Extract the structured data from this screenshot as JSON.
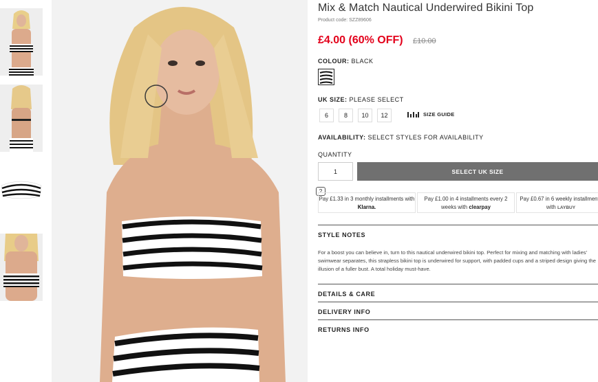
{
  "product": {
    "title": "Mix & Match Nautical Underwired Bikini Top",
    "product_code": "Product code: SZZ89606",
    "price_now": "£4.00 (60% OFF)",
    "price_was": "£10.00"
  },
  "colour": {
    "label": "COLOUR:",
    "value": "BLACK"
  },
  "size": {
    "label": "UK SIZE:",
    "value": "PLEASE SELECT",
    "options": [
      "6",
      "8",
      "10",
      "12"
    ],
    "guide_label": "SIZE GUIDE"
  },
  "availability": {
    "label": "AVAILABILITY:",
    "value": "SELECT STYLES FOR AVAILABILITY"
  },
  "quantity": {
    "label": "QUANTITY",
    "value": "1"
  },
  "select_button": "SELECT UK SIZE",
  "payment": {
    "help": "?",
    "klarna": {
      "text": "Pay £1.33 in 3 monthly installments with",
      "brand": "Klarna."
    },
    "clearpay": {
      "text": "Pay £1.00 in 4 installments every 2 weeks with",
      "brand": "clearpay"
    },
    "laybuy": {
      "text": "Pay £0.67 in 6 weekly installments with",
      "brand": "LAYBUY"
    }
  },
  "sections": {
    "style_notes": "STYLE NOTES",
    "style_notes_text": "For a boost you can believe in, turn to this nautical underwired bikini top. Perfect for mixing and matching with ladies' swimwear separates, this strapless bikini top is underwired for support, with padded cups and a striped design giving the illusion of a fuller bust. A total holiday must-have.",
    "details": "DETAILS & CARE",
    "delivery": "DELIVERY INFO",
    "returns": "RETURNS INFO"
  },
  "icons": [
    "size-guide-icon",
    "question-icon",
    "clearpay-logo-icon",
    "laybuy-logo-icon",
    "stripe-swatch-icon"
  ],
  "colors": {
    "sale_red": "#e3001b",
    "button_grey": "#707070",
    "stripe": "#111111"
  }
}
